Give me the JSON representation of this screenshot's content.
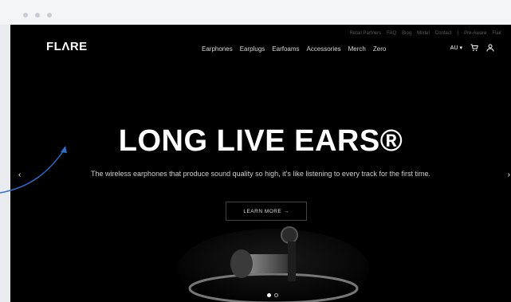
{
  "brand": {
    "logo_text": "FLΛRE"
  },
  "top_links": [
    "Retail Partners",
    "FAQ",
    "Blog",
    "Mixtel",
    "Contact",
    "|",
    "Pre-Aware",
    "Flair"
  ],
  "nav": {
    "items": [
      "Earphones",
      "Earplugs",
      "Earfoams",
      "Accessories",
      "Merch",
      "Zero"
    ]
  },
  "utility": {
    "region": "AU",
    "region_arrow": "▾"
  },
  "hero": {
    "title": "LONG LIVE EARS®",
    "subtitle": "The wireless earphones that produce sound quality so high, it's like listening to every track for the first time.",
    "cta": "LEARN MORE →"
  },
  "carousel": {
    "prev": "‹",
    "next": "›"
  },
  "colors": {
    "accent": "#2f6fd0",
    "chrome": "#f4f5f7",
    "page_bg": "#e9ebee"
  }
}
